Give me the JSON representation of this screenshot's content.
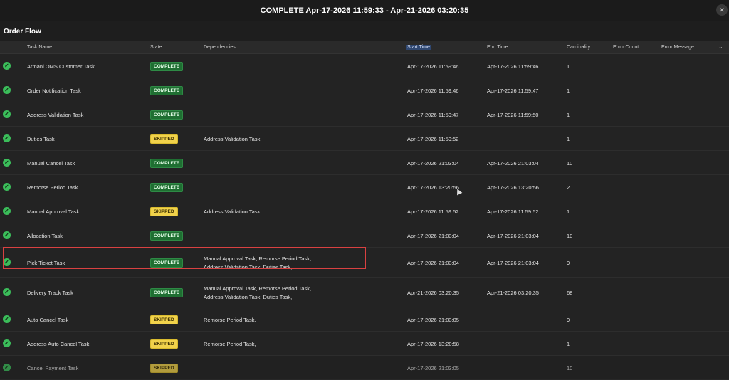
{
  "window": {
    "title": "COMPLETE Apr-17-2026 11:59:33 - Apr-21-2026 03:20:35",
    "close_icon": "close-icon"
  },
  "section": {
    "title": "Order Flow"
  },
  "table": {
    "columns": [
      "Task Name",
      "State",
      "Dependencies",
      "Start Time",
      "End Time",
      "Cardinality",
      "Error Count",
      "Error Message"
    ],
    "highlighted_column": "Start Time",
    "rows": [
      {
        "name": "Armani OMS Customer Task",
        "state": "COMPLETE",
        "deps": [
          "",
          ""
        ],
        "start": "Apr-17-2026 11:59:46",
        "end": "Apr-17-2026 11:59:46",
        "card": "1"
      },
      {
        "name": "Order Notification Task",
        "state": "COMPLETE",
        "deps": [
          "",
          ""
        ],
        "start": "Apr-17-2026 11:59:46",
        "end": "Apr-17-2026 11:59:47",
        "card": "1"
      },
      {
        "name": "Address Validation Task",
        "state": "COMPLETE",
        "deps": [
          "",
          ""
        ],
        "start": "Apr-17-2026 11:59:47",
        "end": "Apr-17-2026 11:59:50",
        "card": "1"
      },
      {
        "name": "Duties Task",
        "state": "SKIPPED",
        "deps": [
          "Address Validation Task,",
          ""
        ],
        "start": "Apr-17-2026 11:59:52",
        "end": "",
        "card": "1"
      },
      {
        "name": "Manual Cancel Task",
        "state": "COMPLETE",
        "deps": [
          "",
          ""
        ],
        "start": "Apr-17-2026 21:03:04",
        "end": "Apr-17-2026 21:03:04",
        "card": "10"
      },
      {
        "name": "Remorse Period Task",
        "state": "COMPLETE",
        "deps": [
          "",
          ""
        ],
        "start": "Apr-17-2026 13:20:56",
        "end": "Apr-17-2026 13:20:56",
        "card": "2"
      },
      {
        "name": "Manual Approval Task",
        "state": "SKIPPED",
        "deps": [
          "Address Validation Task,",
          ""
        ],
        "start": "Apr-17-2026 11:59:52",
        "end": "Apr-17-2026 11:59:52",
        "card": "1"
      },
      {
        "name": "Allocation Task",
        "state": "COMPLETE",
        "deps": [
          "",
          ""
        ],
        "start": "Apr-17-2026 21:03:04",
        "end": "Apr-17-2026 21:03:04",
        "card": "10"
      },
      {
        "name": "Pick Ticket Task",
        "state": "COMPLETE",
        "deps": [
          "Manual Approval Task, Remorse Period Task,",
          "Address Validation Task, Duties Task,"
        ],
        "start": "Apr-17-2026 21:03:04",
        "end": "Apr-17-2026 21:03:04",
        "card": "9"
      },
      {
        "name": "Delivery Track Task",
        "state": "COMPLETE",
        "deps": [
          "Manual Approval Task, Remorse Period Task,",
          "Address Validation Task, Duties Task,"
        ],
        "start": "Apr-21-2026 03:20:35",
        "end": "Apr-21-2026 03:20:35",
        "card": "68"
      },
      {
        "name": "Auto Cancel Task",
        "state": "SKIPPED",
        "deps": [
          "Remorse Period Task,",
          ""
        ],
        "start": "Apr-17-2026 21:03:05",
        "end": "",
        "card": "9"
      },
      {
        "name": "Address Auto Cancel Task",
        "state": "SKIPPED",
        "deps": [
          "Remorse Period Task,",
          ""
        ],
        "start": "Apr-17-2026 13:20:58",
        "end": "",
        "card": "1"
      },
      {
        "name": "Cancel Payment Task",
        "state": "SKIPPED",
        "deps": [
          "",
          ""
        ],
        "start": "Apr-17-2026 21:03:05",
        "end": "",
        "card": "10"
      }
    ]
  },
  "colors": {
    "background": "#1e1e1e",
    "complete_badge": "#1f6f32",
    "skipped_badge": "#f1d24b",
    "check": "#3bbd5a",
    "highlight": "#d94141"
  }
}
